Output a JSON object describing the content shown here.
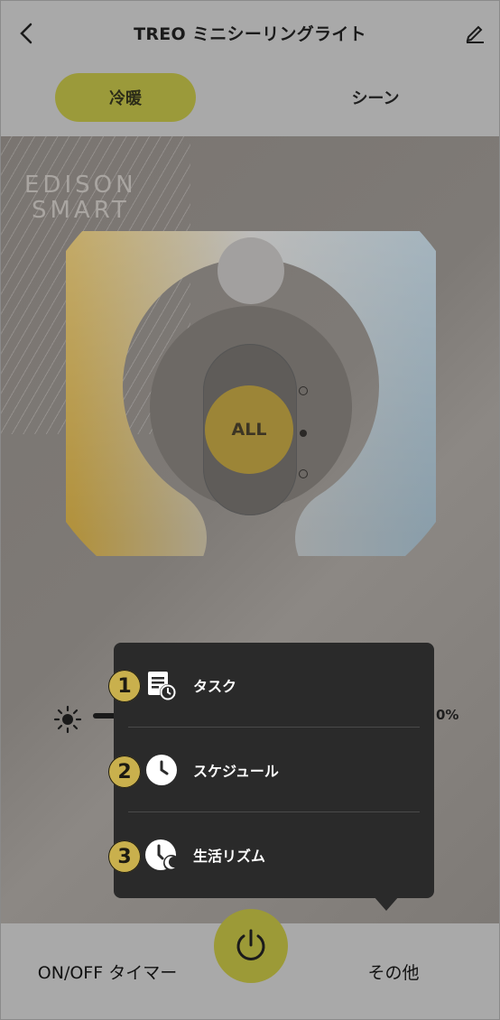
{
  "header": {
    "title": "TREO ミニシーリングライト",
    "back_icon": "chevron-left-icon",
    "edit_icon": "pencil-icon"
  },
  "tabs": [
    {
      "label": "冷暖",
      "active": true
    },
    {
      "label": "シーン",
      "active": false
    }
  ],
  "brand": {
    "line1": "EDISON",
    "line2": "SMART"
  },
  "dial": {
    "center_label": "ALL",
    "colors": {
      "warm": "#b1913c",
      "cool": "#8a9eaa",
      "accent": "#9c8537"
    }
  },
  "brightness": {
    "icon": "sun-icon",
    "value_suffix": "0%"
  },
  "menu": {
    "items": [
      {
        "badge": "1",
        "icon": "task-schedule-icon",
        "label": "タスク"
      },
      {
        "badge": "2",
        "icon": "clock-icon",
        "label": "スケジュール"
      },
      {
        "badge": "3",
        "icon": "clock-moon-icon",
        "label": "生活リズム"
      }
    ]
  },
  "bottom": {
    "left_label": "ON/OFF タイマー",
    "power_icon": "power-icon",
    "right_label": "その他",
    "accent": "#9c9a37"
  }
}
